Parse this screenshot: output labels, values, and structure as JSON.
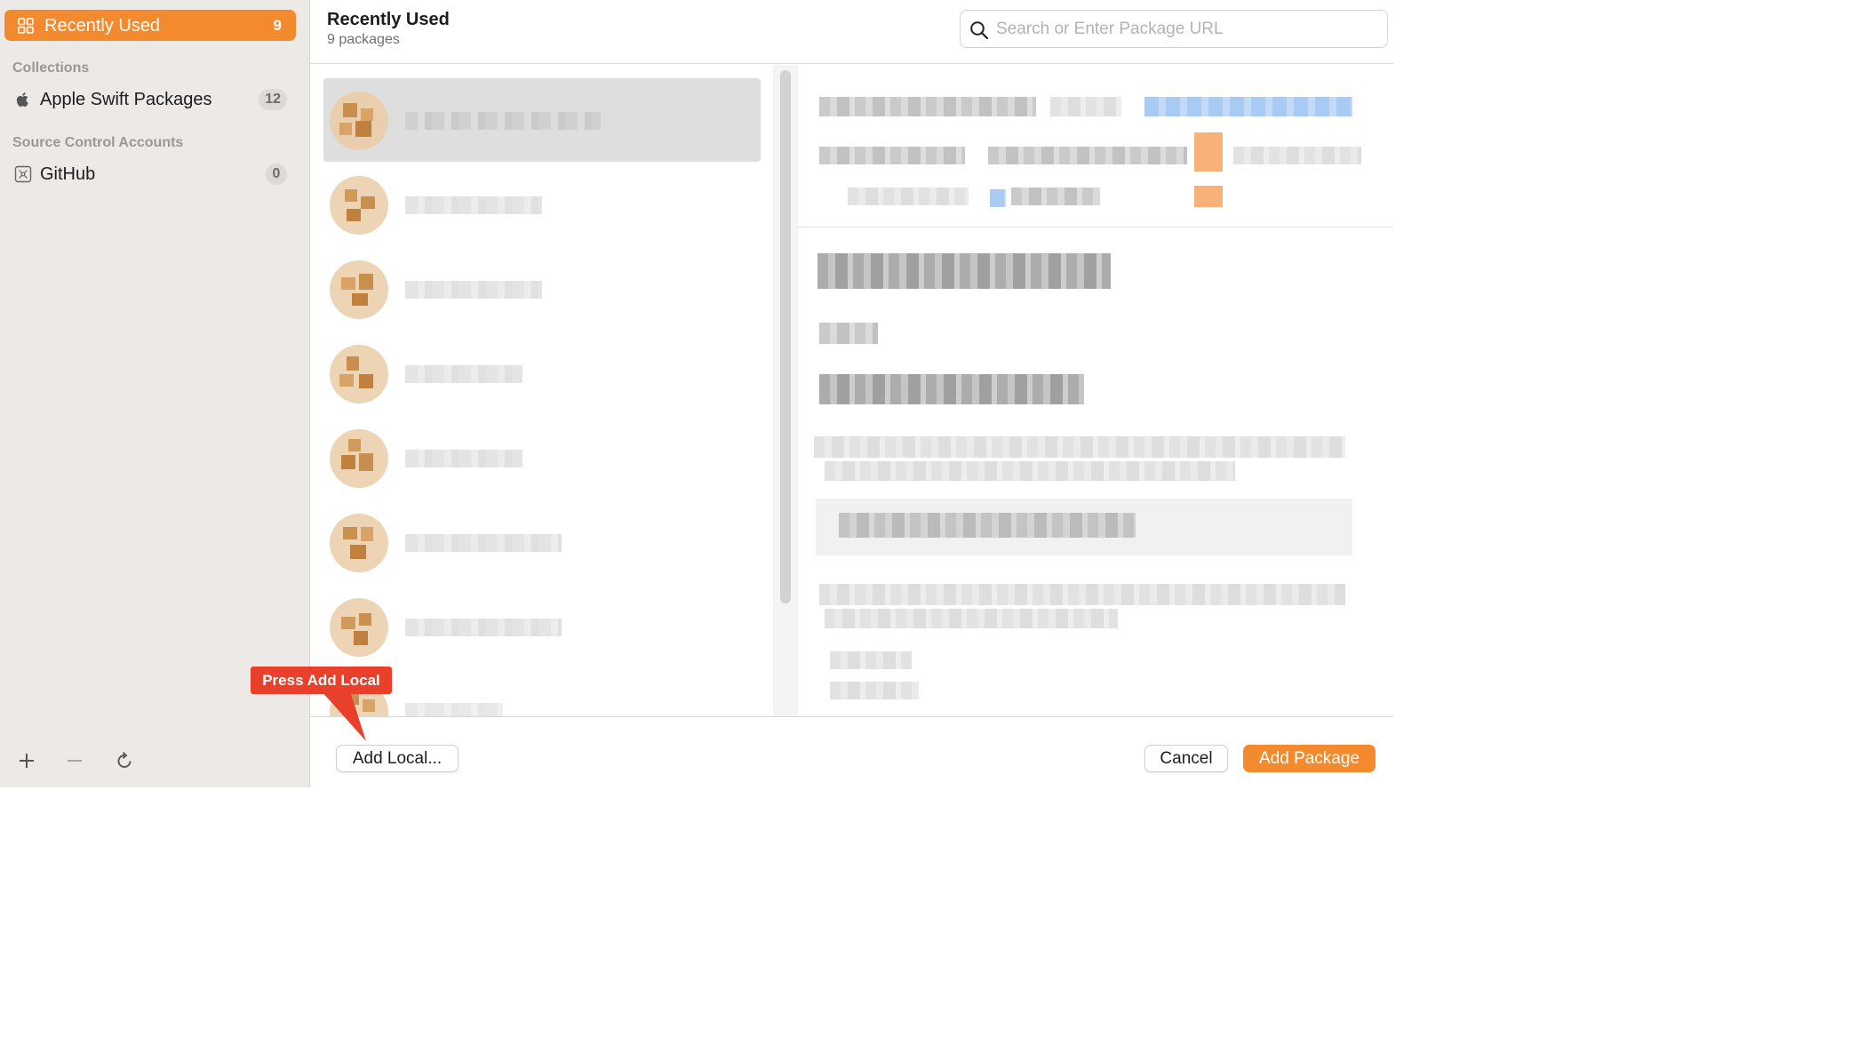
{
  "sidebar": {
    "selected": {
      "label": "Recently Used",
      "count": "9",
      "icon": "grid-icon"
    },
    "collections_heading": "Collections",
    "collections": [
      {
        "label": "Apple Swift Packages",
        "count": "12",
        "icon": "apple-logo-icon"
      }
    ],
    "accounts_heading": "Source Control Accounts",
    "accounts": [
      {
        "label": "GitHub",
        "count": "0",
        "icon": "github-account-icon"
      }
    ],
    "footer_icons": [
      "plus-icon",
      "minus-icon",
      "refresh-icon"
    ]
  },
  "header": {
    "title": "Recently Used",
    "subtitle": "9 packages"
  },
  "search": {
    "placeholder": "Search or Enter Package URL",
    "value": ""
  },
  "footer": {
    "add_local_label": "Add Local...",
    "cancel_label": "Cancel",
    "add_package_label": "Add Package"
  },
  "callout": {
    "text": "Press Add Local"
  },
  "colors": {
    "accent": "#f38a2e",
    "callout": "#e8402a",
    "sidebar_bg": "#ece9e6"
  }
}
